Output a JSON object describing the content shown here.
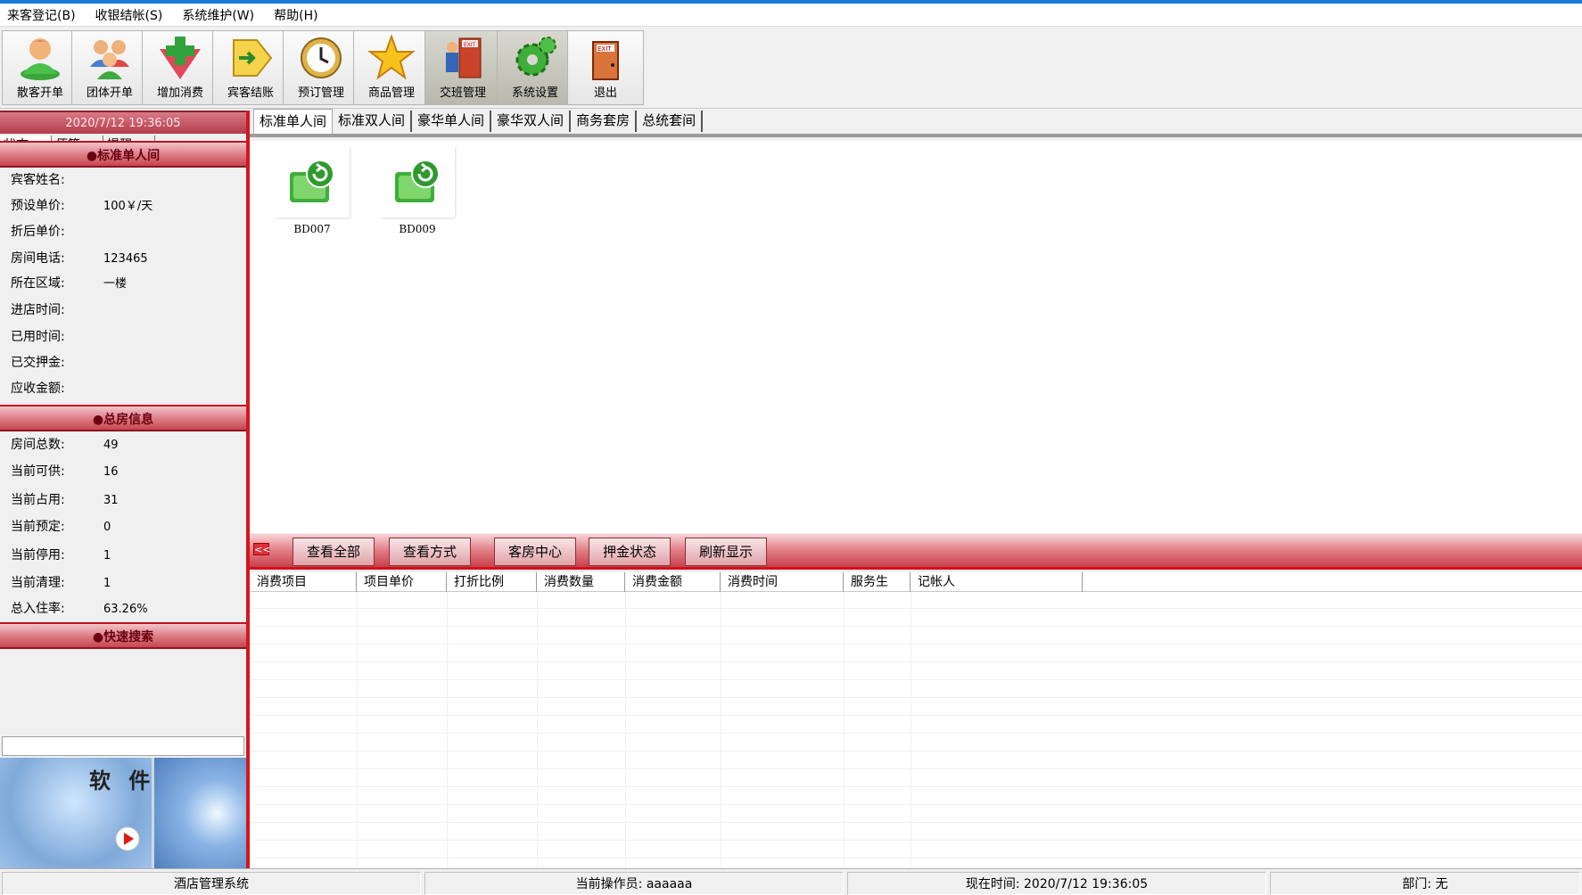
{
  "menu": [
    "来客登记(B)",
    "收银结帐(S)",
    "系统维护(W)",
    "帮助(H)"
  ],
  "toolbar": {
    "walkin": "散客开单",
    "group": "团体开单",
    "add_charge": "增加消费",
    "checkout": "宾客结账",
    "booking": "预订管理",
    "goods": "商品管理",
    "shift": "交班管理",
    "settings": "系统设置",
    "exit": "退出",
    "exit_sign": "EXIT"
  },
  "left": {
    "datetime": "2020/7/12 19:36:05",
    "tabs": [
      "状态",
      "便签",
      "提醒"
    ],
    "room_section": "●标准单人间",
    "room_fields": [
      {
        "k": "宾客姓名:",
        "v": ""
      },
      {
        "k": "预设单价:",
        "v": "100￥/天"
      },
      {
        "k": "折后单价:",
        "v": ""
      },
      {
        "k": "房间电话:",
        "v": "123465"
      },
      {
        "k": "所在区域:",
        "v": "一楼"
      },
      {
        "k": "进店时间:",
        "v": ""
      },
      {
        "k": "已用时间:",
        "v": ""
      },
      {
        "k": "已交押金:",
        "v": ""
      },
      {
        "k": "应收金额:",
        "v": ""
      }
    ],
    "total_section": "●总房信息",
    "total_fields": [
      {
        "k": "房间总数:",
        "v": "49"
      },
      {
        "k": "当前可供:",
        "v": "16"
      },
      {
        "k": "当前占用:",
        "v": "31"
      },
      {
        "k": "当前预定:",
        "v": "0"
      },
      {
        "k": "当前停用:",
        "v": "1"
      },
      {
        "k": "当前清理:",
        "v": "1"
      },
      {
        "k": "总入住率:",
        "v": "63.26%"
      }
    ],
    "search_section": "●快速搜索",
    "search_value": "",
    "banner_text": "软 件"
  },
  "room_tabs": [
    "标准单人间",
    "标准双人间",
    "豪华单人间",
    "豪华双人间",
    "商务套房",
    "总统套间"
  ],
  "rooms": [
    "BD007",
    "BD009"
  ],
  "actions": {
    "collapse": "<<",
    "buttons": [
      "查看全部",
      "查看方式",
      "客房中心",
      "押金状态",
      "刷新显示"
    ]
  },
  "grid_headers": [
    "消费项目",
    "项目单价",
    "打折比例",
    "消费数量",
    "消费金额",
    "消费时间",
    "服务生",
    "记帐人"
  ],
  "status": {
    "app": "酒店管理系统",
    "operator": "当前操作员: aaaaaa",
    "time": "现在时间: 2020/7/12  19:36:05",
    "dept": "部门: 无"
  },
  "colors": {
    "accent_red": "#d4161e",
    "header_red": "#c7454f",
    "room_green": "#3fae3a",
    "title_blue": "#1a78d7"
  }
}
